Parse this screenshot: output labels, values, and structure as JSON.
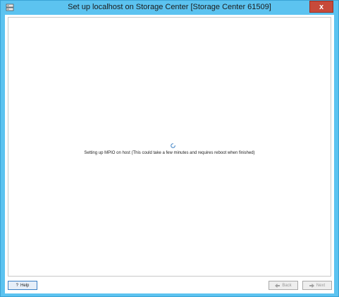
{
  "window": {
    "title": "Set up localhost on Storage Center [Storage Center 61509]",
    "close_label": "x",
    "app_icon": "storage-app-icon"
  },
  "main": {
    "status_text": "Setting up MPIO on host (This could take a few minutes and requires reboot when finished)",
    "spinner_icon": "loading-spinner-icon"
  },
  "footer": {
    "help_label": "Help",
    "help_icon": "question-mark-icon",
    "back_label": "Back",
    "back_icon": "arrow-left-icon",
    "next_label": "Next",
    "next_icon": "arrow-right-icon"
  },
  "colors": {
    "titlebar": "#5cc3f0",
    "close": "#c74a3a",
    "disabled_text": "#9a9a9a"
  }
}
